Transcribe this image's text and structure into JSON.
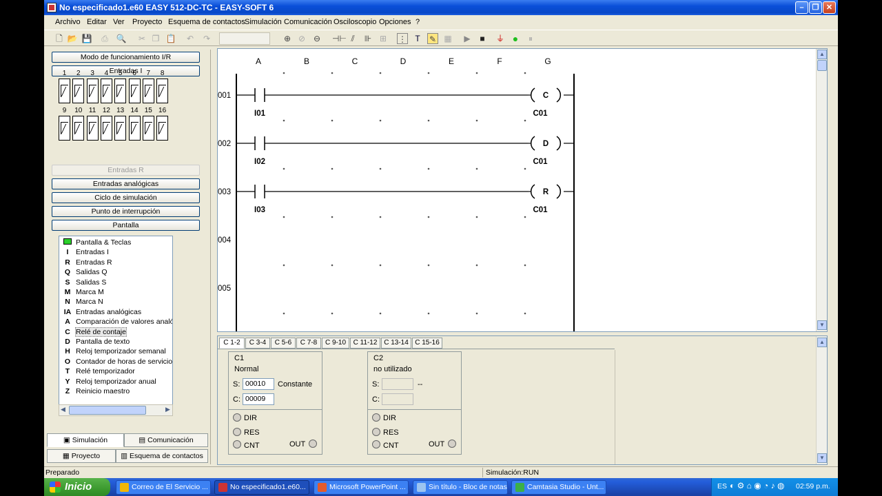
{
  "window": {
    "title": "No especificado1.e60 EASY 512-DC-TC - EASY-SOFT 6"
  },
  "menu": [
    "Archivo",
    "Editar",
    "Ver",
    "Proyecto",
    "Esquema de contactos",
    "Simulación",
    "Comunicación",
    "Osciloscopio",
    "Opciones",
    "?"
  ],
  "left_panel": {
    "btn_mode": "Modo de funcionamiento I/R",
    "btn_inputs_i": "Entradas I",
    "switch_numbers_row1": [
      "1",
      "2",
      "3",
      "4",
      "5",
      "6",
      "7",
      "8"
    ],
    "switch_numbers_row2": [
      "9",
      "10",
      "11",
      "12",
      "13",
      "14",
      "15",
      "16"
    ],
    "btn_inputs_r": "Entradas R",
    "btn_analog": "Entradas analógicas",
    "btn_cycle": "Ciclo de simulación",
    "btn_break": "Punto de interrupción",
    "btn_display": "Pantalla",
    "tree": [
      {
        "sym": "",
        "label": "Pantalla & Teclas"
      },
      {
        "sym": "I",
        "label": "Entradas I"
      },
      {
        "sym": "R",
        "label": "Entradas R"
      },
      {
        "sym": "Q",
        "label": "Salidas Q"
      },
      {
        "sym": "S",
        "label": "Salidas S"
      },
      {
        "sym": "M",
        "label": "Marca M"
      },
      {
        "sym": "N",
        "label": "Marca N"
      },
      {
        "sym": "IA",
        "label": "Entradas analógicas"
      },
      {
        "sym": "A",
        "label": "Comparación de valores analó"
      },
      {
        "sym": "C",
        "label": "Relé de contaje"
      },
      {
        "sym": "D",
        "label": "Pantalla de texto"
      },
      {
        "sym": "H",
        "label": "Reloj temporizador semanal"
      },
      {
        "sym": "O",
        "label": "Contador de horas de servicio"
      },
      {
        "sym": "T",
        "label": "Relé temporizador"
      },
      {
        "sym": "Y",
        "label": "Reloj temporizador anual"
      },
      {
        "sym": "Z",
        "label": "Reinicio maestro"
      }
    ],
    "tabs": [
      "Simulación",
      "Comunicación",
      "Proyecto",
      "Esquema de contactos"
    ]
  },
  "diagram": {
    "columns": [
      "A",
      "B",
      "C",
      "D",
      "E",
      "F",
      "G"
    ],
    "rows": [
      {
        "num": "001",
        "contact": "I01",
        "coil": "C",
        "coil_label": "C01"
      },
      {
        "num": "002",
        "contact": "I02",
        "coil": "D",
        "coil_label": "C01"
      },
      {
        "num": "003",
        "contact": "I03",
        "coil": "R",
        "coil_label": "C01"
      },
      {
        "num": "004"
      },
      {
        "num": "005"
      }
    ]
  },
  "counter_tabs": [
    "C 1-2",
    "C 3-4",
    "C 5-6",
    "C 7-8",
    "C 9-10",
    "C 11-12",
    "C 13-14",
    "C 15-16"
  ],
  "counters": [
    {
      "name": "C1",
      "mode": "Normal",
      "s_label": "S:",
      "s_value": "00010",
      "s_note": "Constante",
      "c_label": "C:",
      "c_value": "00009",
      "dir": "DIR",
      "res": "RES",
      "cnt": "CNT",
      "out": "OUT"
    },
    {
      "name": "C2",
      "mode": "no utilizado",
      "s_label": "S:",
      "s_value": "",
      "s_note": "--",
      "c_label": "C:",
      "c_value": "",
      "dir": "DIR",
      "res": "RES",
      "cnt": "CNT",
      "out": "OUT"
    }
  ],
  "status": {
    "left": "Preparado",
    "sim": "Simulación:RUN"
  },
  "taskbar": {
    "start": "Inicio",
    "tasks": [
      "Correo de El Servicio ...",
      "No especificado1.e60...",
      "Microsoft PowerPoint ...",
      "Sin título - Bloc de notas",
      "Camtasia Studio - Unt..."
    ],
    "lang": "ES",
    "clock": "02:59 p.m."
  }
}
